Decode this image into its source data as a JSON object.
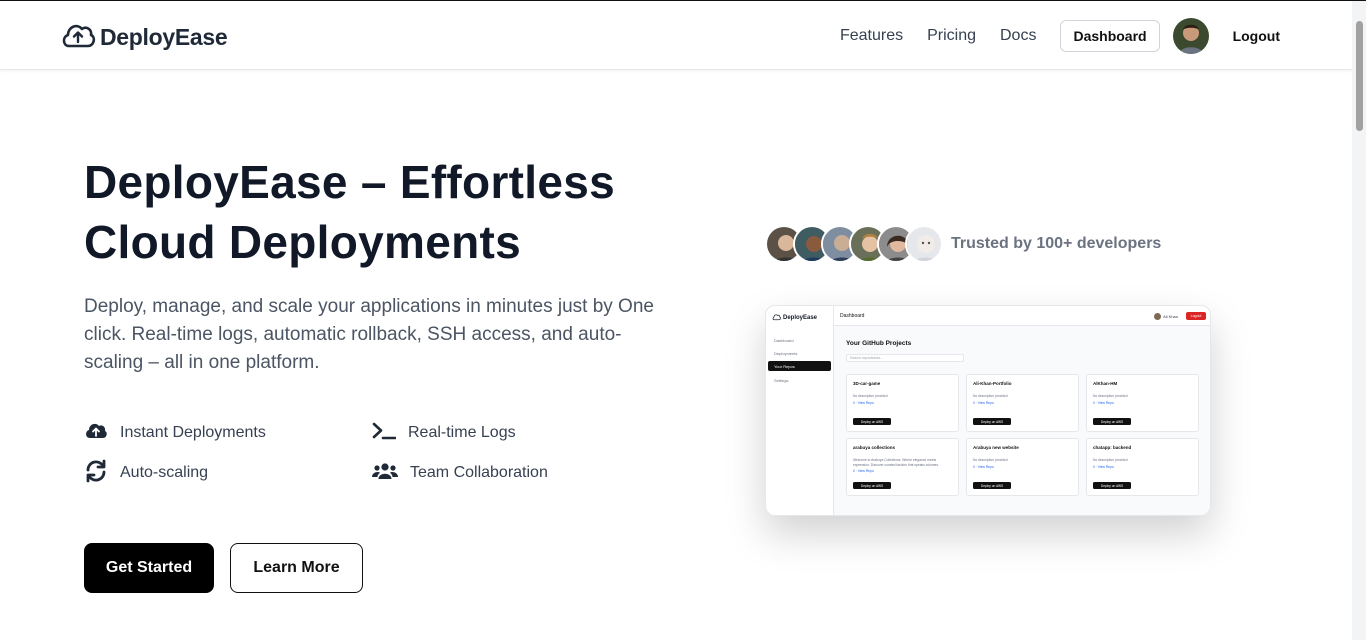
{
  "brand": {
    "name": "DeployEase"
  },
  "nav": {
    "links": [
      "Features",
      "Pricing",
      "Docs"
    ],
    "dashboard_label": "Dashboard",
    "logout_label": "Logout"
  },
  "hero": {
    "title_line1": "DeployEase – Effortless",
    "title_line2": "Cloud Deployments",
    "description": "Deploy, manage, and scale your applications in minutes just by One click. Real-time logs, automatic rollback, SSH access, and auto-scaling – all in one platform.",
    "features": [
      {
        "label": "Instant Deployments",
        "icon": "cloud-upload-icon"
      },
      {
        "label": "Real-time Logs",
        "icon": "terminal-icon"
      },
      {
        "label": "Auto-scaling",
        "icon": "sync-icon"
      },
      {
        "label": "Team Collaboration",
        "icon": "users-icon"
      }
    ],
    "primary_cta": "Get Started",
    "secondary_cta": "Learn More"
  },
  "trusted": {
    "text": "Trusted by 100+ developers",
    "avatar_count": 6
  },
  "preview": {
    "brand": "DeployEase",
    "sidebar": [
      "Dashboard",
      "Deployments",
      "Your Repos",
      "Settings"
    ],
    "active_item": "Your Repos",
    "page_title": "Dashboard",
    "user_name": "Ali Khan",
    "logout": "Logout",
    "heading": "Your GitHub Projects",
    "search_placeholder": "Search repositories...",
    "cards": [
      {
        "name": "3D-car-game",
        "desc": "No description provided",
        "meta": "0 · View Repo",
        "button": "Deploy on AWS"
      },
      {
        "name": "Ali-Khan-Portfolio",
        "desc": "No description provided",
        "meta": "0 · View Repo",
        "button": "Deploy on AWS"
      },
      {
        "name": "AlKhan-HM",
        "desc": "No description provided",
        "meta": "0 · View Repo",
        "button": "Deploy on AWS"
      },
      {
        "name": "arabuya collections",
        "desc": "Welcome to Arabuya Collections. Where elegance meets expression. Discover curated fashion that speaks volumes.",
        "meta": "0 · View Repo",
        "button": "Deploy on AWS"
      },
      {
        "name": "Arabuya new website",
        "desc": "No description provided",
        "meta": "0 · View Repo",
        "button": "Deploy on AWS"
      },
      {
        "name": "chatapp: backend",
        "desc": "No description provided",
        "meta": "0 · View Repo",
        "button": "Deploy on AWS"
      }
    ]
  },
  "colors": {
    "primary": "#000000",
    "heading": "#111827",
    "body_text": "#4b5563",
    "logout_red": "#dc2626"
  }
}
